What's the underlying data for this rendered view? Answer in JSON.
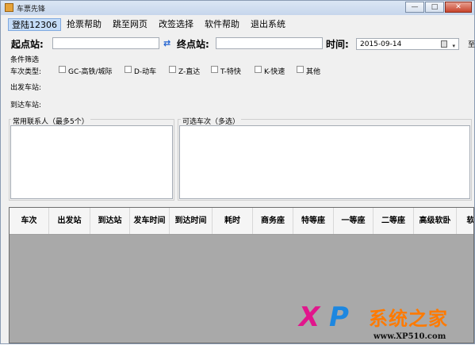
{
  "window": {
    "title": "车票先锋",
    "min_glyph": "—",
    "max_glyph": "□",
    "close_glyph": "✕"
  },
  "menu": {
    "items": [
      "登陆12306",
      "抢票帮助",
      "跳至网页",
      "改签选择",
      "软件帮助",
      "退出系统"
    ]
  },
  "search": {
    "from_label": "起点站:",
    "from_value": "",
    "swap_glyph": "⇄",
    "to_label": "终点站:",
    "to_value": "",
    "time_label": "时间:",
    "date_value": "2015-09-14",
    "dropdown_glyph": "▾",
    "right_edge_text": "至"
  },
  "filters": {
    "group_title": "条件筛选",
    "train_type_label": "车次类型:",
    "train_types": [
      {
        "label": "GC-高铁/城际",
        "checked": false
      },
      {
        "label": "D-动车",
        "checked": false
      },
      {
        "label": "Z-直达",
        "checked": false
      },
      {
        "label": "T-特快",
        "checked": false
      },
      {
        "label": "K-快速",
        "checked": false
      },
      {
        "label": "其他",
        "checked": false
      }
    ],
    "departure_station_label": "出发车站:",
    "arrival_station_label": "到达车站:"
  },
  "contacts": {
    "title": "常用联系人（最多5个）"
  },
  "trains": {
    "title": "可选车次（多选）"
  },
  "table": {
    "columns": [
      "车次",
      "出发站",
      "到达站",
      "发车时间",
      "到达时间",
      "耗时",
      "商务座",
      "特等座",
      "一等座",
      "二等座",
      "高级软卧",
      "软"
    ]
  },
  "watermark": {
    "x": "X",
    "p": "P",
    "name": "系统之家",
    "url": "www.XP510.com"
  },
  "colors": {
    "window_bg": "#f0f0f0",
    "grid_bg": "#a9a9a9",
    "accent_blue": "#1c5fd0",
    "watermark_magenta": "#e1168c",
    "watermark_orange": "#ff7a00"
  }
}
